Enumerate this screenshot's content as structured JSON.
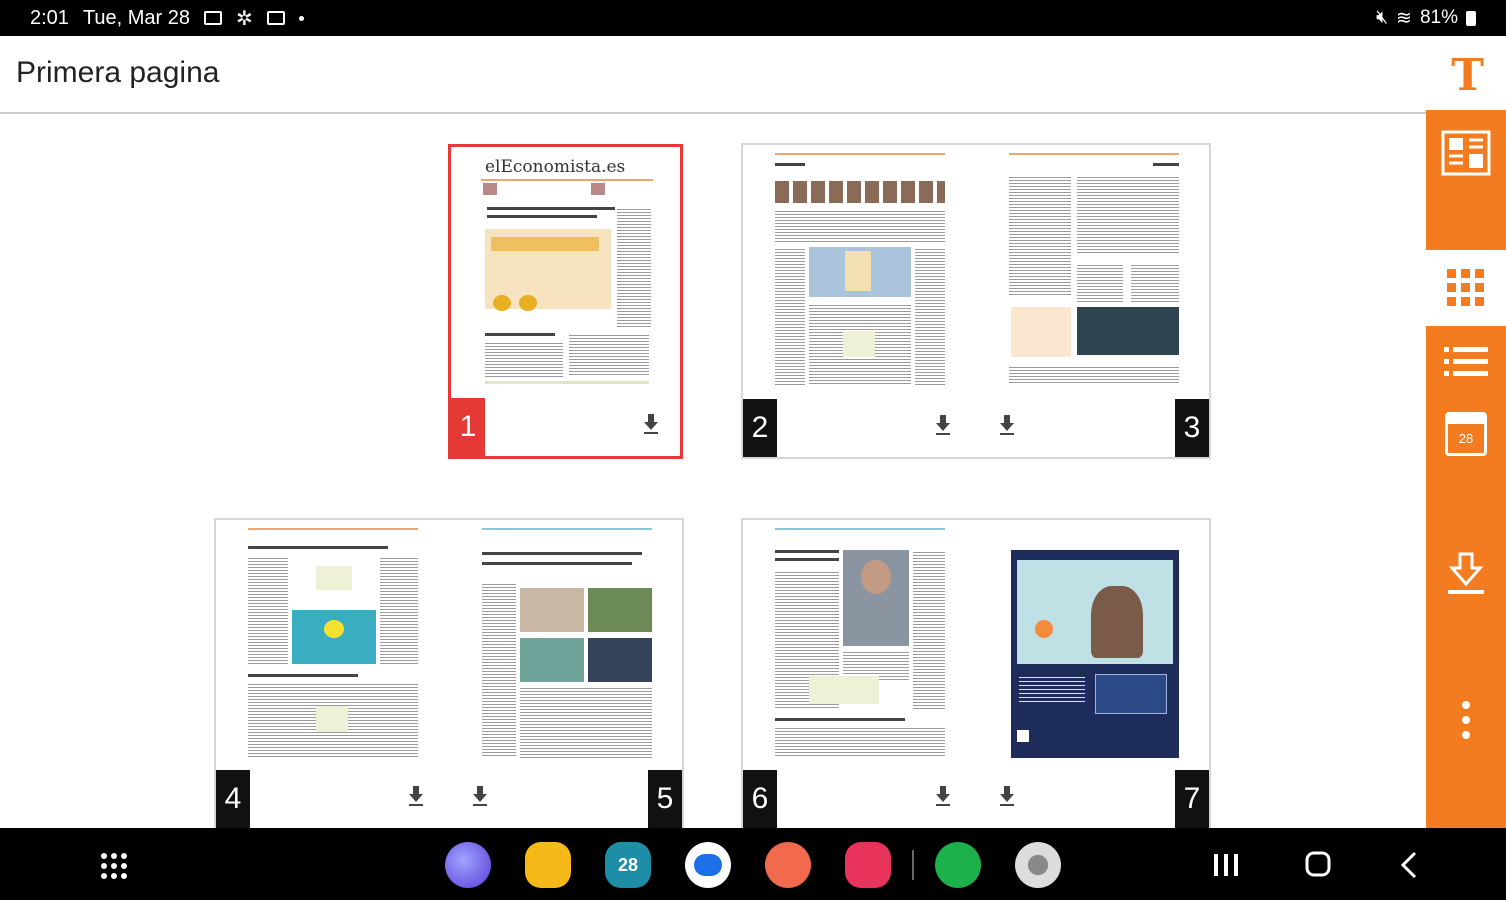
{
  "status": {
    "time": "2:01",
    "date": "Tue, Mar 28",
    "battery": "81%"
  },
  "header": {
    "title": "Primera pagina",
    "logo": "T"
  },
  "masthead": "elEconomista.es",
  "pages": [
    {
      "number": "1",
      "selected": true
    },
    {
      "number": "2"
    },
    {
      "number": "3"
    },
    {
      "number": "4"
    },
    {
      "number": "5"
    },
    {
      "number": "6"
    },
    {
      "number": "7"
    }
  ],
  "sidebar": {
    "items": [
      {
        "icon": "page-layout-icon",
        "active": true
      },
      {
        "icon": "grid-icon"
      },
      {
        "icon": "list-icon"
      },
      {
        "icon": "calendar-icon",
        "label": "28"
      },
      {
        "icon": "download-icon"
      },
      {
        "icon": "more-vert-icon"
      }
    ]
  },
  "dock": {
    "calendar_label": "28",
    "apps": [
      "internet-app-icon",
      "files-app-icon",
      "calendar-app-icon",
      "messages-app-icon",
      "contacts-app-icon",
      "camera-app-icon",
      "health-app-icon",
      "gallery-app-icon"
    ]
  },
  "colors": {
    "accent": "#f47c20",
    "selected": "#e53935"
  }
}
